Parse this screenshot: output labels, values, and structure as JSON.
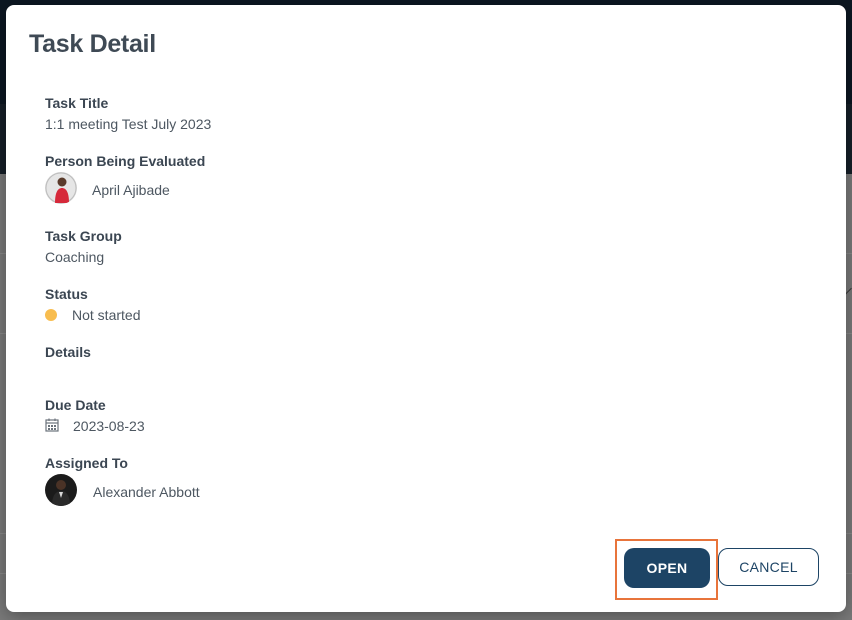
{
  "dialog": {
    "title": "Task Detail"
  },
  "fields": {
    "task_title": {
      "label": "Task Title",
      "value": "1:1 meeting Test July 2023"
    },
    "person": {
      "label": "Person Being Evaluated",
      "name": "April Ajibade",
      "avatar_icon": "person-avatar"
    },
    "task_group": {
      "label": "Task Group",
      "value": "Coaching"
    },
    "status": {
      "label": "Status",
      "value": "Not started",
      "dot_color": "#f8bd4f"
    },
    "details": {
      "label": "Details",
      "value": ""
    },
    "due_date": {
      "label": "Due Date",
      "value": "2023-08-23",
      "icon": "calendar-icon"
    },
    "assigned_to": {
      "label": "Assigned To",
      "name": "Alexander Abbott",
      "avatar_icon": "person-avatar"
    }
  },
  "actions": {
    "open_label": "OPEN",
    "cancel_label": "CANCEL"
  },
  "colors": {
    "primary": "#1d4465",
    "highlight": "#e8743b",
    "status_not_started": "#f8bd4f"
  }
}
